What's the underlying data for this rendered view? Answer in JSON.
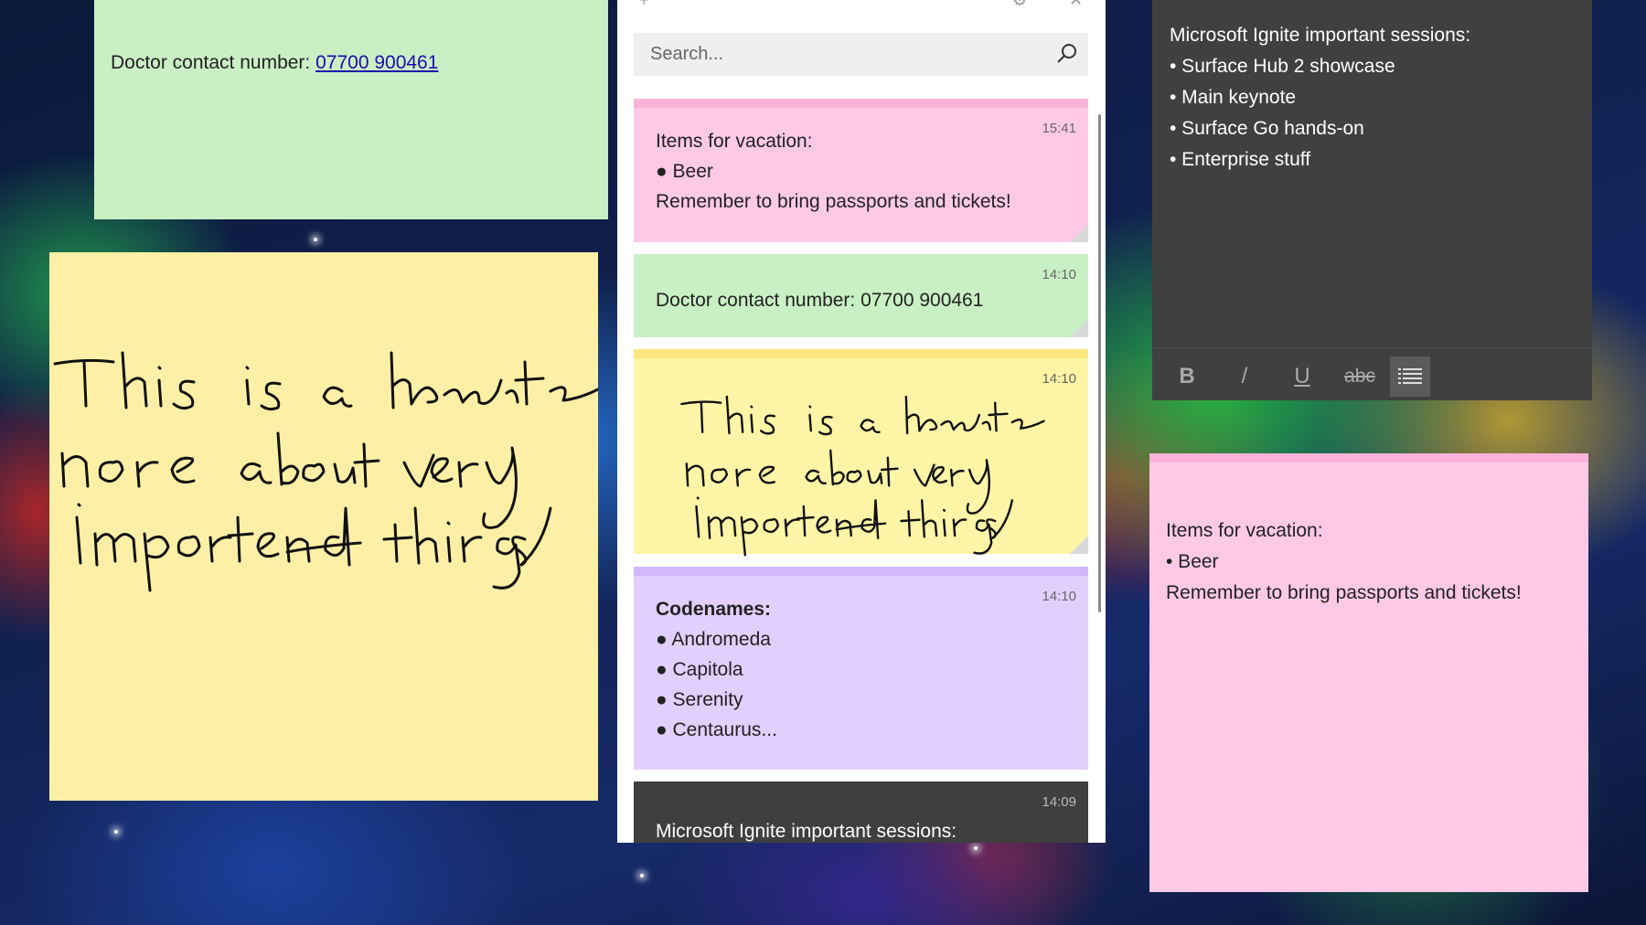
{
  "left_green_note": {
    "label": "Doctor contact number: ",
    "phone": "07700 900461"
  },
  "list_panel": {
    "search_placeholder": "Search...",
    "cards": [
      {
        "time": "15:41",
        "lines": [
          "Items for vacation:",
          "● Beer",
          "Remember to bring passports and tickets!"
        ]
      },
      {
        "time": "14:10",
        "lines": [
          "Doctor contact number: 07700 900461"
        ]
      },
      {
        "time": "14:10",
        "handwriting": true
      },
      {
        "time": "14:10",
        "title": "Codenames:",
        "lines": [
          "● Andromeda",
          "● Capitola",
          "● Serenity",
          "● Centaurus..."
        ]
      },
      {
        "time": "14:09",
        "lines": [
          "Microsoft Ignite important sessions:"
        ]
      }
    ]
  },
  "dark_note": {
    "lines": [
      "Microsoft Ignite important sessions:",
      "• Surface Hub 2 showcase",
      "• Main keynote",
      "• Surface Go hands-on",
      "• Enterprise stuff"
    ],
    "toolbar": {
      "bold": "B",
      "italic": "/",
      "underline": "U",
      "strike": "abc"
    }
  },
  "pink_note": {
    "lines": [
      "Items for vacation:",
      "• Beer",
      "Remember to bring passports and tickets!"
    ]
  },
  "colors": {
    "green_note": "#cbefc5",
    "yellow_note": "#fdf0a6",
    "pink_note": "#fdc9e6",
    "purple_note": "#e2cffe",
    "dark_note": "#404040"
  }
}
